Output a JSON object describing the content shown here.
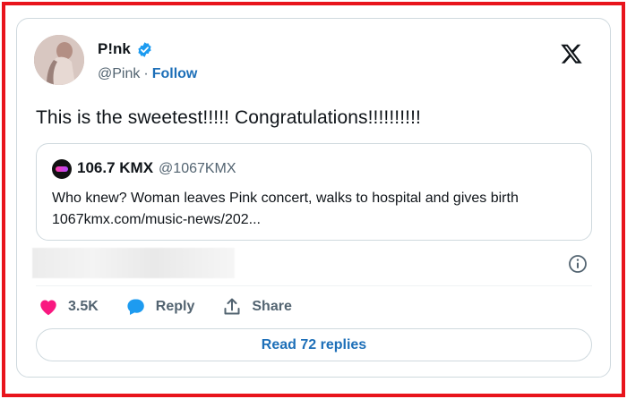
{
  "author": {
    "name": "P!nk",
    "handle": "@Pink",
    "separator": "·",
    "follow_label": "Follow",
    "verified": true
  },
  "tweet": {
    "text": "This is the sweetest!!!!! Congratulations!!!!!!!!!!"
  },
  "quoted": {
    "name": "106.7 KMX",
    "handle": "@1067KMX",
    "text_line1": "Who knew? Woman leaves Pink concert, walks to hospital and gives birth",
    "text_line2": "1067kmx.com/music-news/202..."
  },
  "actions": {
    "likes": "3.5K",
    "reply_label": "Reply",
    "share_label": "Share"
  },
  "read_replies_label": "Read 72 replies",
  "colors": {
    "frame": "#e8141c",
    "like": "#f91880",
    "reply": "#1d9bf0",
    "link": "#1d6fb8"
  },
  "icons": [
    "verified-badge-icon",
    "x-logo-icon",
    "info-icon",
    "heart-icon",
    "reply-bubble-icon",
    "share-icon"
  ]
}
